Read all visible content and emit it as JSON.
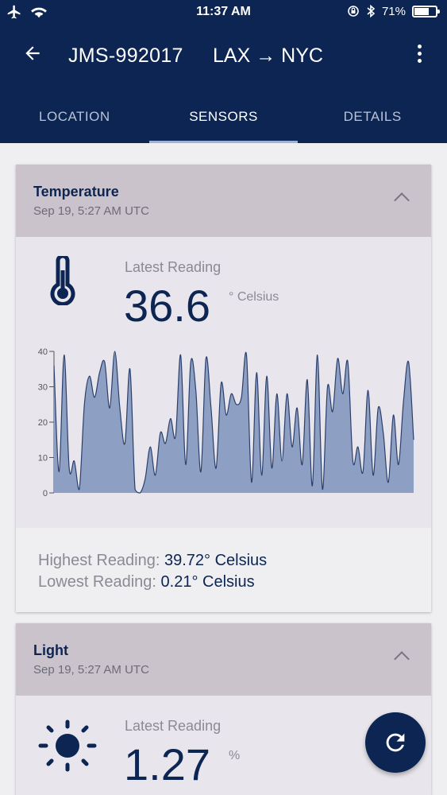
{
  "status_bar": {
    "time": "11:37 AM",
    "battery": "71%",
    "battery_level": 0.71,
    "icons": [
      "airplane-icon",
      "wifi-icon",
      "orientation-lock-icon",
      "bluetooth-icon",
      "battery-icon"
    ]
  },
  "app_bar": {
    "title": "JMS-992017",
    "route": "LAX → NYC",
    "icons": [
      "back-arrow-icon",
      "more-vert-icon"
    ]
  },
  "tabs": [
    {
      "label": "LOCATION",
      "active": false
    },
    {
      "label": "SENSORS",
      "active": true
    },
    {
      "label": "DETAILS",
      "active": false
    }
  ],
  "temperature_card": {
    "title": "Temperature",
    "timestamp": "Sep 19, 5:27 AM UTC",
    "reading_label": "Latest Reading",
    "value": "36.6",
    "unit": "° Celsius",
    "highest_label": "Highest Reading:",
    "highest_value": "39.72° Celsius",
    "lowest_label": "Lowest Reading:",
    "lowest_value": "0.21° Celsius",
    "icon": "thermometer-icon"
  },
  "light_card": {
    "title": "Light",
    "timestamp": "Sep 19, 5:27 AM UTC",
    "reading_label": "Latest Reading",
    "value": "1.27",
    "unit": "%",
    "icon": "sun-icon"
  },
  "colors": {
    "primary": "#0c2552",
    "card_header": "#cbc3cb",
    "chart_fill": "#8da0c4",
    "chart_line": "#2b3f6b"
  },
  "chart_data": {
    "type": "area",
    "title": "",
    "xlabel": "",
    "ylabel": "",
    "ylim": [
      0,
      40
    ],
    "yticks": [
      "0",
      "10",
      "20",
      "30",
      "40"
    ],
    "grid": false,
    "values": [
      36,
      6,
      39,
      7,
      9,
      1,
      25,
      33,
      27,
      34,
      37,
      24,
      40,
      24,
      14,
      35,
      1,
      0,
      4,
      13,
      5,
      17,
      14,
      21,
      16,
      39,
      8,
      37,
      29,
      6,
      38,
      24,
      7,
      31,
      22,
      28,
      25,
      27,
      39,
      3,
      34,
      5,
      33,
      7,
      28,
      9,
      28,
      13,
      24,
      8,
      32,
      2,
      39,
      1,
      30,
      23,
      38,
      28,
      37,
      9,
      13,
      6,
      29,
      5,
      24,
      17,
      3,
      22,
      8,
      26,
      37,
      15
    ]
  }
}
